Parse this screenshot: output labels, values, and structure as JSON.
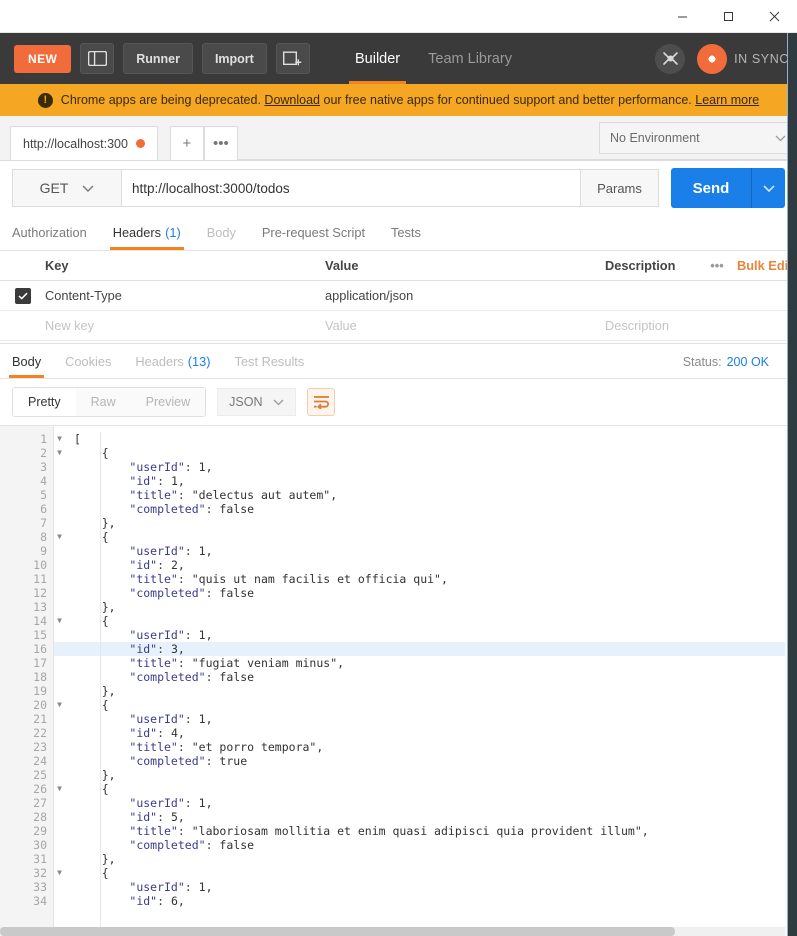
{
  "window": {
    "minimize_label": "Minimize",
    "maximize_label": "Maximize",
    "close_label": "Close"
  },
  "toolbar": {
    "new_label": "NEW",
    "sidebar_toggle_name": "sidebar-toggle",
    "runner_label": "Runner",
    "import_label": "Import",
    "new_window_name": "new-window",
    "modes": [
      {
        "label": "Builder",
        "active": true
      },
      {
        "label": "Team Library",
        "active": false
      }
    ],
    "interceptor_icon": "satellite-icon",
    "sync_icon": "sync-icon",
    "sync_label": "IN SYNC"
  },
  "notice": {
    "icon": "alert-icon",
    "text_before": "Chrome apps are being deprecated.",
    "link1": "Download",
    "text_middle": "our free native apps for continued support and better performance.",
    "link2": "Learn more"
  },
  "tabstrip": {
    "tab_label": "http://localhost:300",
    "unsaved_indicator": true,
    "add_tab_label": "+",
    "more_label": "•••",
    "environment": {
      "value": "No Environment",
      "caret": "chevron-down-icon"
    }
  },
  "request": {
    "method": "GET",
    "url": "http://localhost:3000/todos",
    "params_label": "Params",
    "send_label": "Send",
    "send_caret": "chevron-down-icon",
    "tabs": [
      {
        "label": "Authorization",
        "active": false,
        "dim": false
      },
      {
        "label": "Headers",
        "count": "(1)",
        "active": true,
        "dim": false
      },
      {
        "label": "Body",
        "active": false,
        "dim": true
      },
      {
        "label": "Pre-request Script",
        "active": false,
        "dim": false
      },
      {
        "label": "Tests",
        "active": false,
        "dim": false
      }
    ]
  },
  "headers_table": {
    "columns": [
      "Key",
      "Value",
      "Description"
    ],
    "more_label": "•••",
    "bulk_edit_label": "Bulk Edit",
    "rows": [
      {
        "checked": true,
        "key": "Content-Type",
        "value": "application/json",
        "description": ""
      }
    ],
    "new_row": {
      "key": "New key",
      "value": "Value",
      "description": "Description"
    }
  },
  "response": {
    "tabs": [
      {
        "label": "Body",
        "active": true
      },
      {
        "label": "Cookies",
        "active": false
      },
      {
        "label": "Headers",
        "count": "(13)",
        "active": false
      },
      {
        "label": "Test Results",
        "active": false
      }
    ],
    "status_label": "Status:",
    "status_value": "200 OK",
    "view_modes": [
      {
        "label": "Pretty",
        "active": true
      },
      {
        "label": "Raw",
        "active": false
      },
      {
        "label": "Preview",
        "active": false
      }
    ],
    "format": "JSON",
    "format_caret": "chevron-down-icon",
    "wrap_icon": "wrap-lines-icon"
  },
  "code": {
    "highlight_line": 16,
    "lines": [
      {
        "n": 1,
        "fold": true,
        "text": "["
      },
      {
        "n": 2,
        "fold": true,
        "text": "    {"
      },
      {
        "n": 3,
        "fold": false,
        "text": "        \"userId\": 1,"
      },
      {
        "n": 4,
        "fold": false,
        "text": "        \"id\": 1,"
      },
      {
        "n": 5,
        "fold": false,
        "text": "        \"title\": \"delectus aut autem\","
      },
      {
        "n": 6,
        "fold": false,
        "text": "        \"completed\": false"
      },
      {
        "n": 7,
        "fold": false,
        "text": "    },"
      },
      {
        "n": 8,
        "fold": true,
        "text": "    {"
      },
      {
        "n": 9,
        "fold": false,
        "text": "        \"userId\": 1,"
      },
      {
        "n": 10,
        "fold": false,
        "text": "        \"id\": 2,"
      },
      {
        "n": 11,
        "fold": false,
        "text": "        \"title\": \"quis ut nam facilis et officia qui\","
      },
      {
        "n": 12,
        "fold": false,
        "text": "        \"completed\": false"
      },
      {
        "n": 13,
        "fold": false,
        "text": "    },"
      },
      {
        "n": 14,
        "fold": true,
        "text": "    {"
      },
      {
        "n": 15,
        "fold": false,
        "text": "        \"userId\": 1,"
      },
      {
        "n": 16,
        "fold": false,
        "text": "        \"id\": 3,"
      },
      {
        "n": 17,
        "fold": false,
        "text": "        \"title\": \"fugiat veniam minus\","
      },
      {
        "n": 18,
        "fold": false,
        "text": "        \"completed\": false"
      },
      {
        "n": 19,
        "fold": false,
        "text": "    },"
      },
      {
        "n": 20,
        "fold": true,
        "text": "    {"
      },
      {
        "n": 21,
        "fold": false,
        "text": "        \"userId\": 1,"
      },
      {
        "n": 22,
        "fold": false,
        "text": "        \"id\": 4,"
      },
      {
        "n": 23,
        "fold": false,
        "text": "        \"title\": \"et porro tempora\","
      },
      {
        "n": 24,
        "fold": false,
        "text": "        \"completed\": true"
      },
      {
        "n": 25,
        "fold": false,
        "text": "    },"
      },
      {
        "n": 26,
        "fold": true,
        "text": "    {"
      },
      {
        "n": 27,
        "fold": false,
        "text": "        \"userId\": 1,"
      },
      {
        "n": 28,
        "fold": false,
        "text": "        \"id\": 5,"
      },
      {
        "n": 29,
        "fold": false,
        "text": "        \"title\": \"laboriosam mollitia et enim quasi adipisci quia provident illum\","
      },
      {
        "n": 30,
        "fold": false,
        "text": "        \"completed\": false"
      },
      {
        "n": 31,
        "fold": false,
        "text": "    },"
      },
      {
        "n": 32,
        "fold": true,
        "text": "    {"
      },
      {
        "n": 33,
        "fold": false,
        "text": "        \"userId\": 1,"
      },
      {
        "n": 34,
        "fold": false,
        "text": "        \"id\": 6,"
      }
    ]
  },
  "colors": {
    "accent_orange": "#f26b3a",
    "notice_bg": "#f5a623",
    "send_blue": "#1a7fe8",
    "toolbar_dark": "#3a3a3a",
    "status_blue": "#1a7fe8"
  }
}
